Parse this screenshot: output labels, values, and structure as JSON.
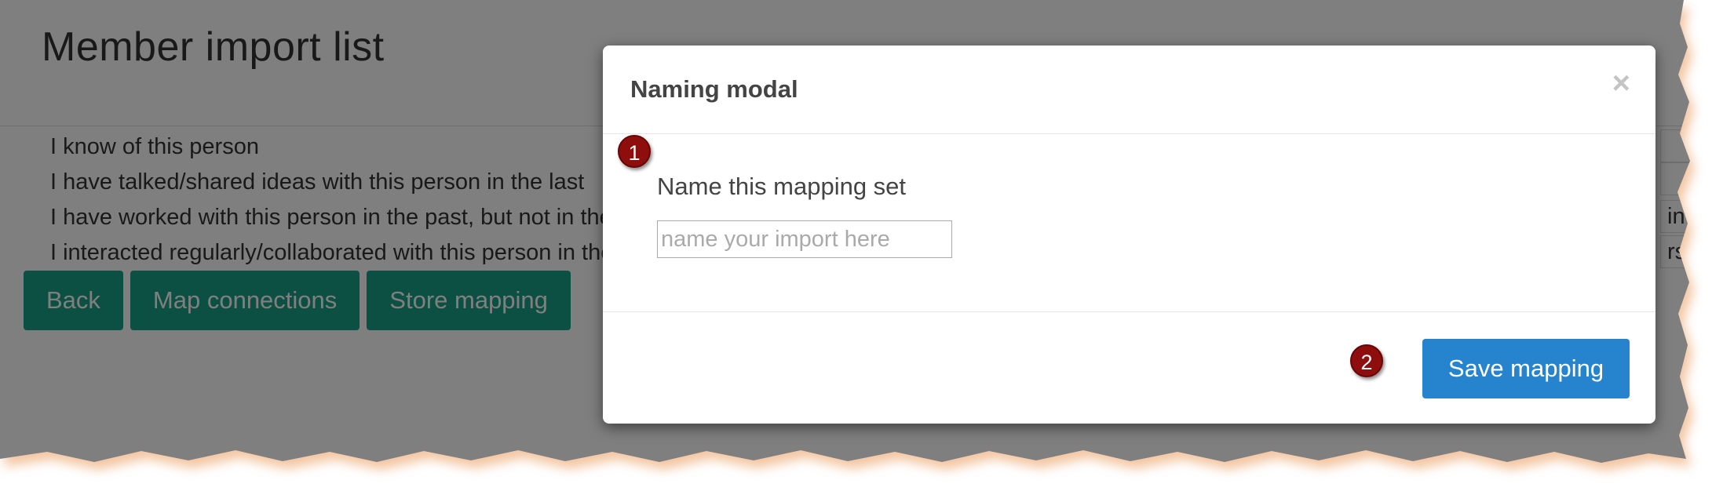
{
  "page": {
    "title": "Member import list",
    "scale_items": [
      "I know of this person",
      "I have talked/shared ideas with this person in the last",
      "I have worked with this person in the past, but not in the last year",
      "I interacted regularly/collaborated with this person in the last two years"
    ],
    "right_cell_fragments": [
      "",
      "",
      "in",
      "rs"
    ],
    "buttons": {
      "back": "Back",
      "map_connections": "Map connections",
      "store_mapping": "Store mapping"
    }
  },
  "modal": {
    "title": "Naming modal",
    "close_glyph": "×",
    "field_label": "Name this mapping set",
    "input_placeholder": "name your import here",
    "input_value": "",
    "save_label": "Save mapping"
  },
  "annotations": {
    "step1": "1",
    "step2": "2"
  },
  "colors": {
    "teal_button": "#18a086",
    "primary_button": "#2584cd",
    "badge": "#8e0e0e"
  }
}
